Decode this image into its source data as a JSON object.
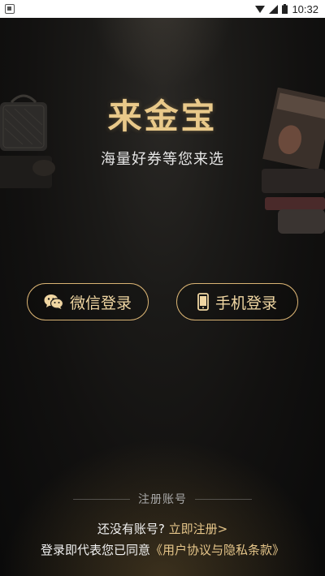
{
  "status_bar": {
    "time": "10:32",
    "icons": [
      "notification-icon",
      "wifi-icon",
      "signal-icon",
      "battery-icon"
    ]
  },
  "app": {
    "title": "来金宝",
    "subtitle": "海量好券等您来选"
  },
  "login": {
    "wechat_label": "微信登录",
    "phone_label": "手机登录"
  },
  "register": {
    "divider_label": "注册账号",
    "no_account_text": "还没有账号?",
    "register_link": "立即注册>",
    "agreement_prefix": "登录即代表您已同意",
    "agreement_link": "《用户协议与隐私条款》"
  },
  "colors": {
    "accent": "#e9c98a",
    "button_border": "#d9b373",
    "background": "#121110"
  }
}
